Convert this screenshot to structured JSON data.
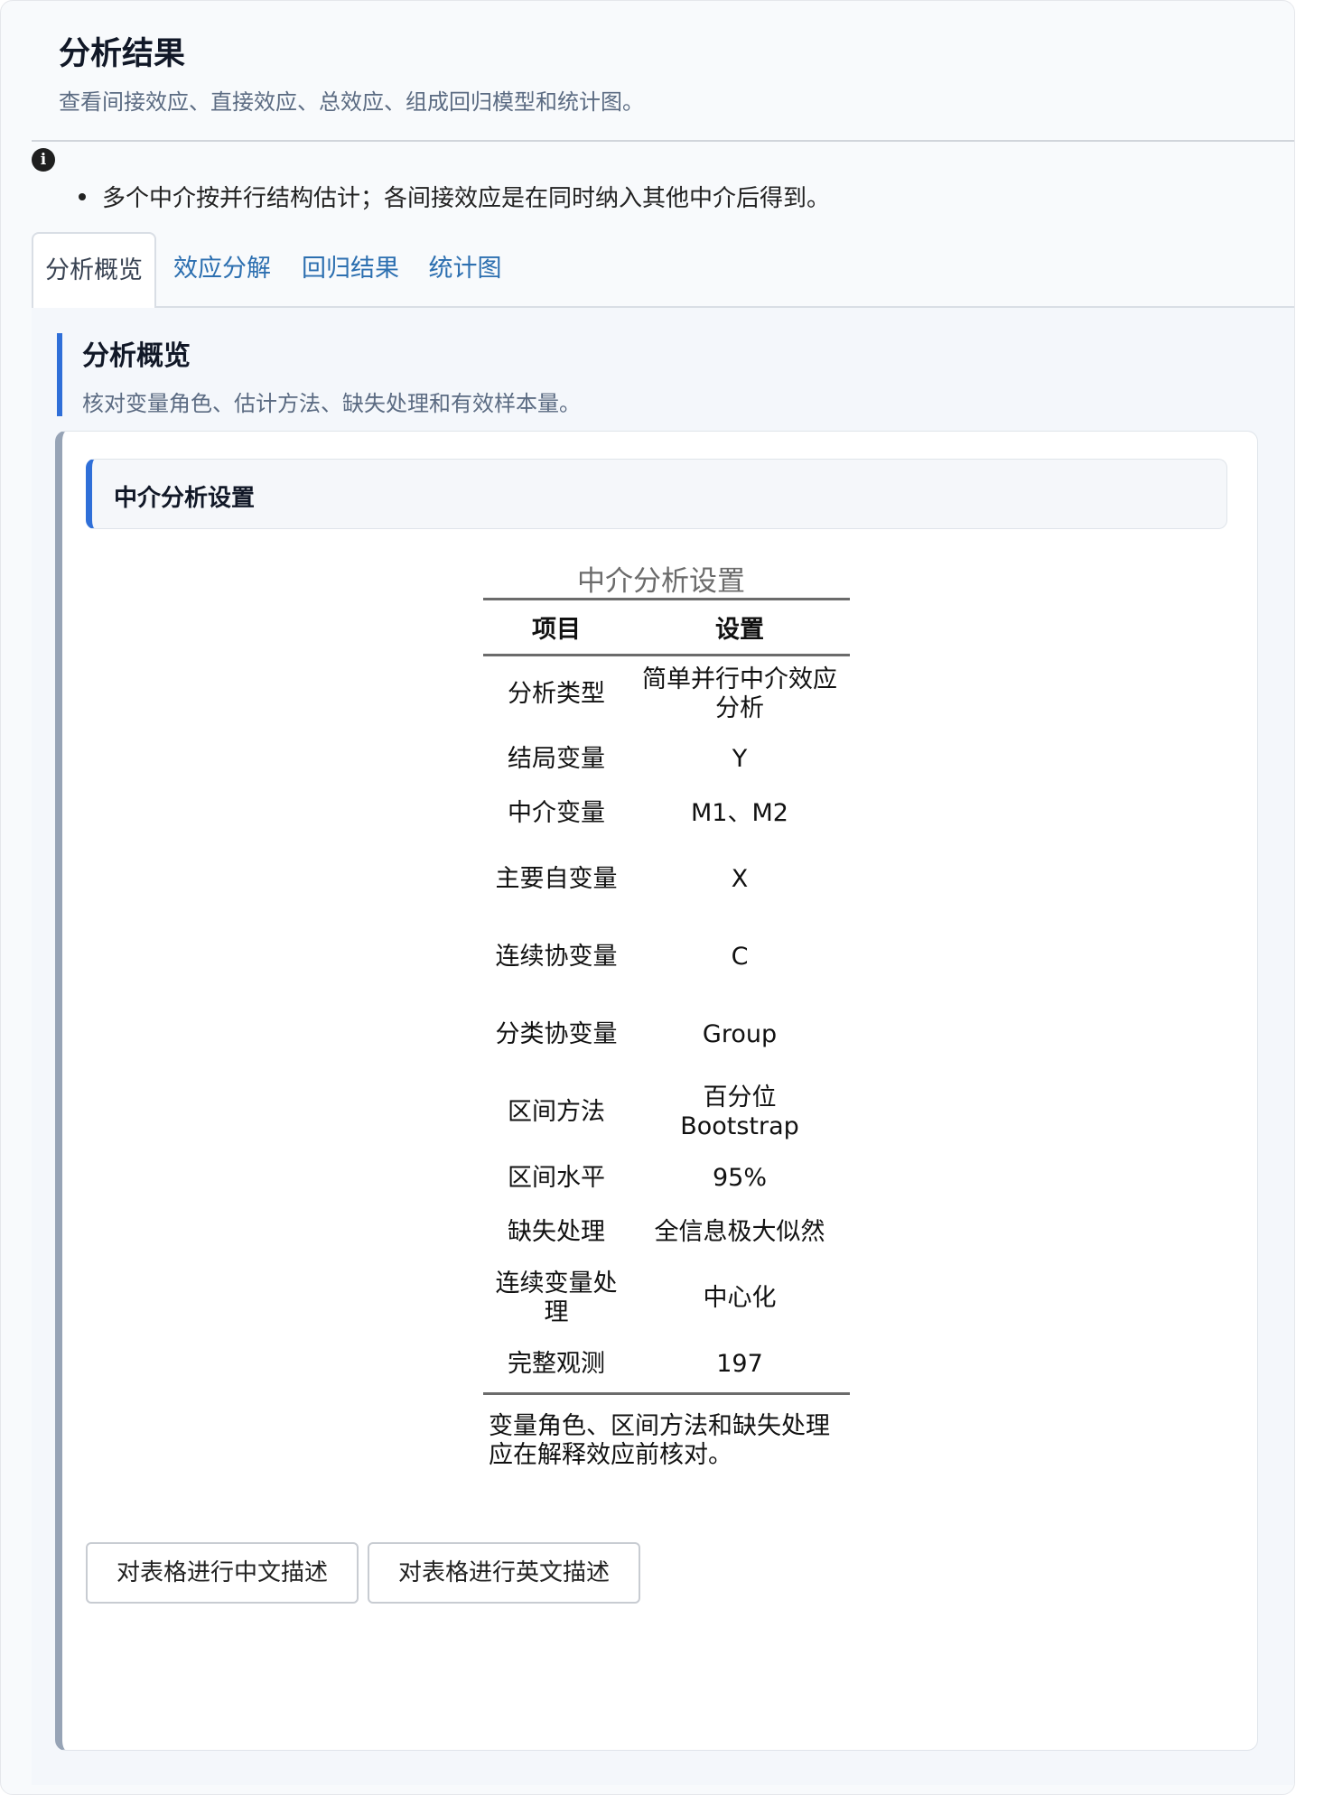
{
  "header": {
    "title": "分析结果",
    "subtitle": "查看间接效应、直接效应、总效应、组成回归模型和统计图。"
  },
  "notes": {
    "icon": "info-icon",
    "items": [
      "多个中介按并行结构估计；各间接效应是在同时纳入其他中介后得到。"
    ]
  },
  "tabs": [
    {
      "label": "分析概览",
      "active": true
    },
    {
      "label": "效应分解",
      "active": false
    },
    {
      "label": "回归结果",
      "active": false
    },
    {
      "label": "统计图",
      "active": false
    }
  ],
  "section": {
    "title": "分析概览",
    "subtitle": "核对变量角色、估计方法、缺失处理和有效样本量。"
  },
  "card": {
    "title": "中介分析设置",
    "table": {
      "caption": "中介分析设置",
      "headers": [
        "项目",
        "设置"
      ],
      "rows": [
        [
          "分析类型",
          "简单并行中介效应分析"
        ],
        [
          "结局变量",
          "Y"
        ],
        [
          "中介变量",
          "M1、M2"
        ],
        [
          "主要自变量",
          "X"
        ],
        [
          "连续协变量",
          "C"
        ],
        [
          "分类协变量",
          "Group"
        ],
        [
          "区间方法",
          "百分位 Bootstrap"
        ],
        [
          "区间水平",
          "95%"
        ],
        [
          "缺失处理",
          "全信息极大似然"
        ],
        [
          "连续变量处理",
          "中心化"
        ],
        [
          "完整观测",
          "197"
        ]
      ],
      "note": "变量角色、区间方法和缺失处理应在解释效应前核对。"
    },
    "buttons": {
      "describe_cn": "对表格进行中文描述",
      "describe_en": "对表格进行英文描述"
    }
  },
  "colors": {
    "accent": "#2f6fd8",
    "tab_link": "#2c6fb0",
    "card_border_left": "#97a4b6"
  }
}
